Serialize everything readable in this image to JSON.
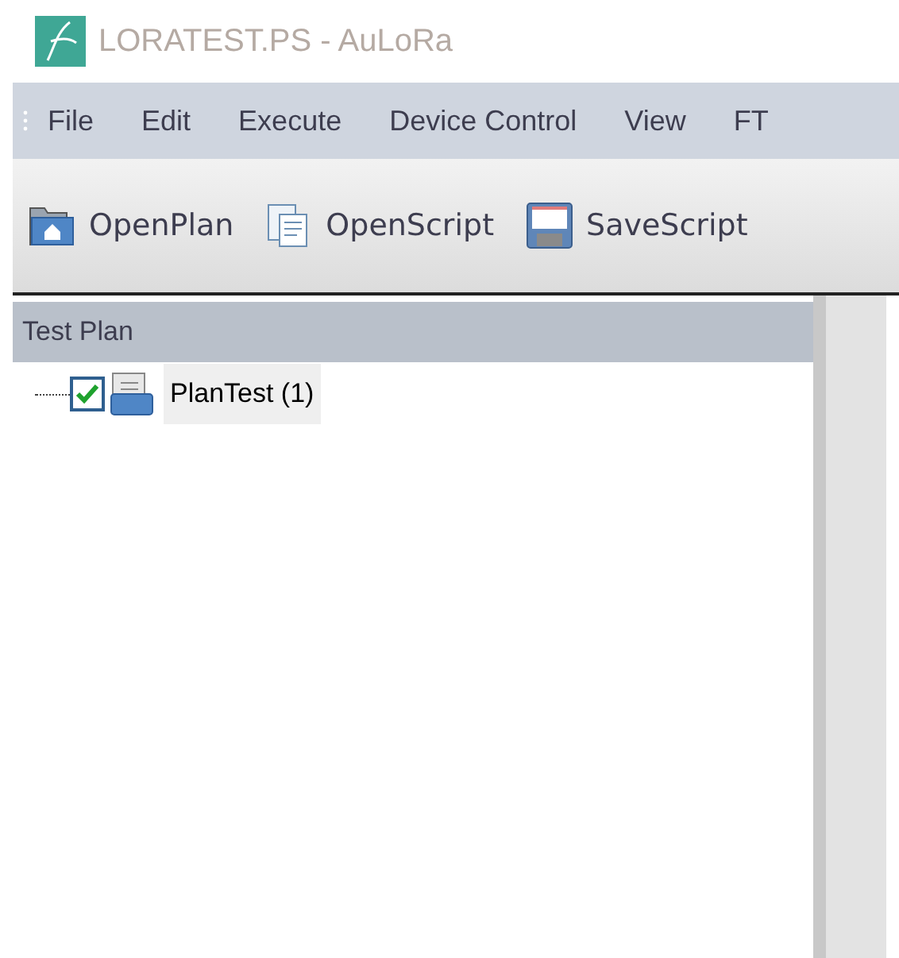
{
  "window": {
    "title": "LORATEST.PS - AuLoRa"
  },
  "menu": [
    "File",
    "Edit",
    "Execute",
    "Device Control",
    "View",
    "FT"
  ],
  "toolbar": [
    {
      "kind": "open-plan",
      "label": "OpenPlan"
    },
    {
      "kind": "open-script",
      "label": "OpenScript"
    },
    {
      "kind": "save-script",
      "label": "SaveScript"
    }
  ],
  "panel": {
    "title": "Test Plan",
    "tree": [
      {
        "label": "PlanTest (1)",
        "checked": true,
        "selected": true
      }
    ]
  }
}
